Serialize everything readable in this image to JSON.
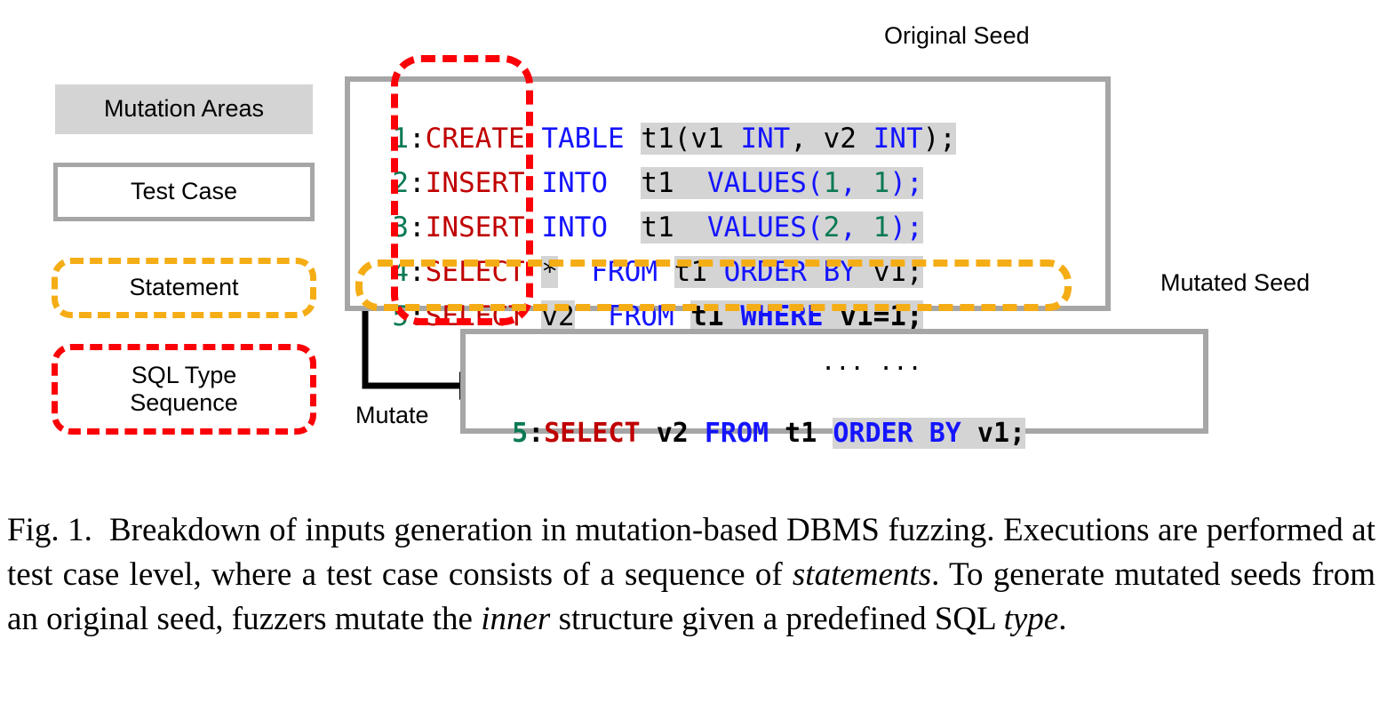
{
  "diagram": {
    "top_label_original_seed": "Original Seed",
    "side_label_mutated_seed": "Mutated Seed",
    "mutate_label": "Mutate",
    "ellipsis": "... ...",
    "legend": [
      {
        "id": "mutation-areas",
        "label": "Mutation Areas",
        "style": "grey-fill",
        "color": "#d4d4d4"
      },
      {
        "id": "test-case",
        "label": "Test Case",
        "style": "solid-grey-border",
        "color": "#a6a6a6"
      },
      {
        "id": "statement",
        "label": "Statement",
        "style": "dashed-orange-border",
        "color": "#f5ad16"
      },
      {
        "id": "sql-type-sequence",
        "label": "SQL Type\nSequence",
        "label_line1": "SQL Type",
        "label_line2": "Sequence",
        "style": "dashed-red-border",
        "color": "#fb0007"
      }
    ],
    "original_seed_lines": [
      {
        "num": "1",
        "colon": ":",
        "type": "CREATE",
        "mid": "TABLE",
        "rest": "t1(v1 INT, v2 INT);"
      },
      {
        "num": "2",
        "colon": ":",
        "type": "INSERT",
        "mid": "INTO",
        "rest": "t1  VALUES(1, 1);"
      },
      {
        "num": "3",
        "colon": ":",
        "type": "INSERT",
        "mid": "INTO",
        "rest": "t1  VALUES(2, 1);"
      },
      {
        "num": "4",
        "colon": ":",
        "type": "SELECT",
        "mid": "*",
        "rest": "FROM t1 ORDER BY v1;"
      },
      {
        "num": "5",
        "colon": ":",
        "type": "SELECT",
        "mid": "v2",
        "rest": "FROM t1 WHERE v1=1;"
      }
    ],
    "mutated_seed_line": {
      "num": "5",
      "colon": ":",
      "type": "SELECT",
      "mid": "v2",
      "rest": "FROM t1 ORDER BY v1;"
    },
    "colors": {
      "keyword_red": "#c00000",
      "keyword_blue": "#1414ff",
      "number_green": "#0b7a54",
      "highlight_grey": "#d4d4d4",
      "box_grey": "#a6a6a6",
      "dashed_orange": "#f5ad16",
      "dashed_red": "#fb0007"
    }
  },
  "caption": {
    "figure_number": "Fig. 1.",
    "text": "Breakdown of inputs generation in mutation-based DBMS fuzzing. Executions are performed at test case level, where a test case consists of a sequence of statements. To generate mutated seeds from an original seed, fuzzers mutate the inner structure given a predefined SQL type.",
    "part1": "Breakdown of inputs generation in mutation-based DBMS fuzzing. Executions are performed at test case level, where a test case consists of a sequence of ",
    "italic1": "statements",
    "part2": ". To generate mutated seeds from an original seed, fuzzers mutate the ",
    "italic2": "inner",
    "part3": " structure given a predefined SQL ",
    "italic3": "type",
    "part4": "."
  }
}
